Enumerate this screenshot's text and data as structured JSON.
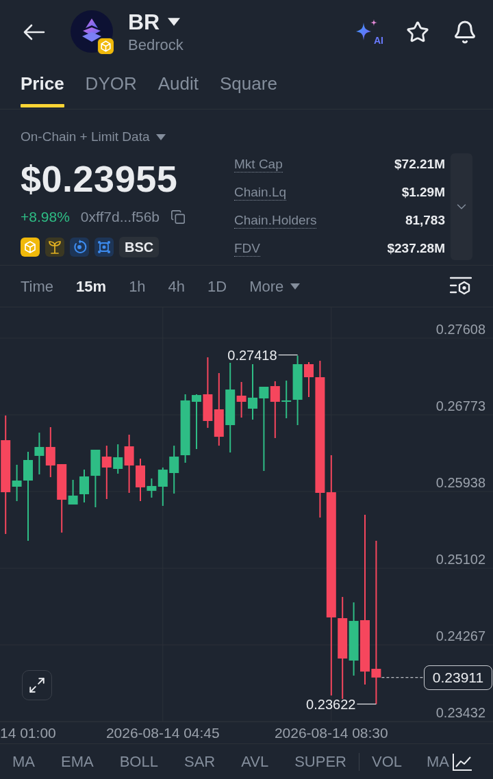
{
  "token": {
    "symbol": "BR",
    "name": "Bedrock"
  },
  "ai_button": {
    "label": "AI"
  },
  "tabs": [
    {
      "label": "Price",
      "selected": true
    },
    {
      "label": "DYOR",
      "selected": false
    },
    {
      "label": "Audit",
      "selected": false
    },
    {
      "label": "Square",
      "selected": false
    }
  ],
  "quote": {
    "source": "On-Chain + Limit Data",
    "price": "$0.23955",
    "change": "+8.98%",
    "up": true,
    "address": "0xff7d...f56b",
    "chain": "BSC"
  },
  "stats": [
    {
      "label": "Mkt Cap",
      "value": "$72.21M"
    },
    {
      "label": "Chain.Lq",
      "value": "$1.29M"
    },
    {
      "label": "Chain.Holders",
      "value": "81,783"
    },
    {
      "label": "FDV",
      "value": "$237.28M"
    }
  ],
  "intervals": [
    {
      "label": "Time",
      "kind": "option",
      "selected": false
    },
    {
      "label": "15m",
      "kind": "option",
      "selected": true
    },
    {
      "label": "1h",
      "kind": "option",
      "selected": false
    },
    {
      "label": "4h",
      "kind": "option",
      "selected": false
    },
    {
      "label": "1D",
      "kind": "option",
      "selected": false
    },
    {
      "label": "More",
      "kind": "menu",
      "selected": false
    }
  ],
  "chart": {
    "chart_data": {
      "type": "candlestick",
      "categories": [
        null,
        null,
        null,
        null,
        null,
        null,
        null,
        null,
        null,
        null,
        null,
        null,
        null,
        null,
        "2026-08-14 04:45",
        null,
        null,
        null,
        null,
        null,
        null,
        null,
        null,
        null,
        null,
        null,
        null,
        null,
        null,
        "2026-08-14 08:30",
        null,
        null,
        null,
        null
      ],
      "ohlc": [
        [
          0.26497,
          0.26766,
          0.25475,
          0.2593
        ],
        [
          0.2599,
          0.26229,
          0.25833,
          0.26057
        ],
        [
          0.26057,
          0.2637,
          0.25401,
          0.26281
        ],
        [
          0.26326,
          0.26579,
          0.26124,
          0.26423
        ],
        [
          0.26423,
          0.26639,
          0.26094,
          0.26221
        ],
        [
          0.26236,
          0.26236,
          0.2549,
          0.25848
        ],
        [
          0.25796,
          0.26065,
          0.25796,
          0.25893
        ],
        [
          0.25908,
          0.26176,
          0.25818,
          0.26102
        ],
        [
          0.26109,
          0.26393,
          0.25766,
          0.26393
        ],
        [
          0.26318,
          0.26437,
          0.25856,
          0.26199
        ],
        [
          0.26184,
          0.26452,
          0.26132,
          0.26311
        ],
        [
          0.2643,
          0.26557,
          0.25923,
          0.26221
        ],
        [
          0.26221,
          0.26296,
          0.25833,
          0.25983
        ],
        [
          0.25945,
          0.2608,
          0.25871,
          0.25998
        ],
        [
          0.2599,
          0.26199,
          0.25781,
          0.26176
        ],
        [
          0.26139,
          0.26437,
          0.25915,
          0.26318
        ],
        [
          0.26333,
          0.26997,
          0.26251,
          0.2693
        ],
        [
          0.26915,
          0.26997,
          0.264,
          0.26989
        ],
        [
          0.26997,
          0.274,
          0.26631,
          0.26706
        ],
        [
          0.26833,
          0.27228,
          0.26437,
          0.26534
        ],
        [
          0.26661,
          0.2734,
          0.26363,
          0.27049
        ],
        [
          0.26982,
          0.27131,
          0.26743,
          0.26915
        ],
        [
          0.2684,
          0.27325,
          0.26721,
          0.2696
        ],
        [
          0.26952,
          0.27079,
          0.26162,
          0.27079
        ],
        [
          0.27086,
          0.27139,
          0.2652,
          0.26915
        ],
        [
          0.26915,
          0.27146,
          0.26736,
          0.2693
        ],
        [
          0.26937,
          0.27418,
          0.26661,
          0.27325
        ],
        [
          0.27325,
          0.27347,
          0.26967,
          0.27183
        ],
        [
          0.27183,
          0.27362,
          0.25654,
          0.25923
        ],
        [
          0.2593,
          0.26333,
          0.23715,
          0.24566
        ],
        [
          0.24558,
          0.24789,
          0.23678,
          0.24118
        ],
        [
          0.24096,
          0.2473,
          0.23932,
          0.24528
        ],
        [
          0.24536,
          0.25684,
          0.23835,
          0.23976
        ],
        [
          0.24006,
          0.25401,
          0.23622,
          0.23911
        ]
      ],
      "ylim": [
        0.23432,
        0.27944
      ],
      "grid": true,
      "yticks": [
        {
          "value": 0.27608,
          "label": "0.27608"
        },
        {
          "value": 0.26773,
          "label": "0.26773"
        },
        {
          "value": 0.25938,
          "label": "0.25938"
        },
        {
          "value": 0.25102,
          "label": "0.25102"
        },
        {
          "value": 0.24267,
          "label": "0.24267"
        },
        {
          "value": 0.23432,
          "label": "0.23432"
        }
      ]
    },
    "edge_time_label": "14 01:00",
    "high_label": "0.27418",
    "low_label": "0.23622",
    "last_price": "0.23911"
  },
  "indicators": {
    "main": [
      "MA",
      "EMA",
      "BOLL",
      "SAR",
      "AVL",
      "SUPER"
    ],
    "sub": [
      "VOL",
      "MA"
    ]
  }
}
